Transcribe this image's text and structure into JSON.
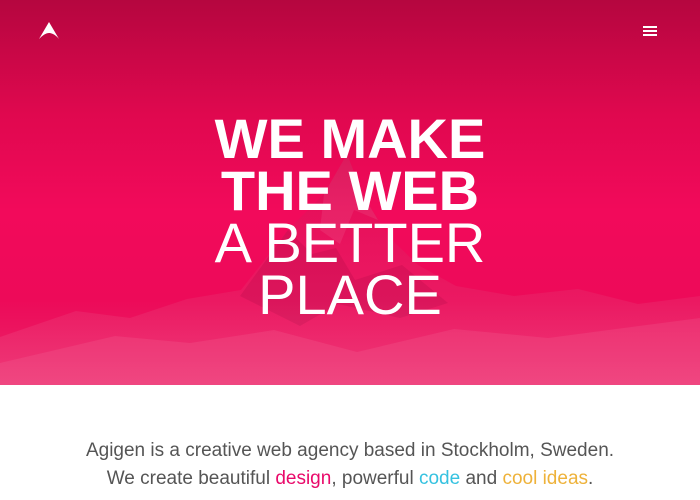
{
  "header": {
    "logo_icon": "triangle-logo-icon",
    "menu_icon": "hamburger-menu-icon"
  },
  "hero": {
    "headline_line_1": "WE MAKE",
    "headline_line_2": "THE WEB",
    "headline_line_3": "A BETTER",
    "headline_line_4": "PLACE",
    "background_color": "#f20a5b",
    "background_image": "mountain-peak"
  },
  "intro": {
    "line_1": "Agigen is a creative web agency based in Stockholm, Sweden.",
    "line_2_start": "We create beautiful ",
    "design": "design",
    "separator_1": ", powerful ",
    "code": "code",
    "separator_2": " and ",
    "cool_ideas": "cool ideas",
    "line_2_end": ".",
    "colors": {
      "design": "#e9096a",
      "code": "#35c2e0",
      "cool_ideas": "#eeb23a"
    }
  }
}
